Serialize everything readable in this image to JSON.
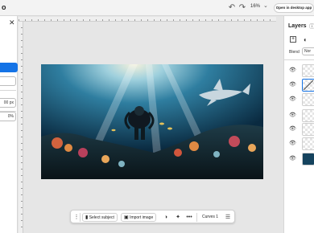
{
  "topbar": {
    "logo_text": "o",
    "undo_icon": "undo-icon",
    "redo_icon": "redo-icon",
    "zoom_label": "16%",
    "open_desktop_label": "Open in desktop app"
  },
  "left_panel": {
    "close_icon": "close-icon",
    "field_width": "00 px",
    "field_percent": "0%"
  },
  "bottom_toolbar": {
    "select_subject_label": "Select subject",
    "import_image_label": "Import image",
    "curves_label": "Curves 1"
  },
  "layers_panel": {
    "title": "Layers",
    "blend_label": "Blend",
    "blend_value": "Nor",
    "layers": [
      {
        "type": "adjustment",
        "selected": false
      },
      {
        "type": "adjustment",
        "selected": true
      },
      {
        "type": "adjustment",
        "selected": false
      },
      {
        "type": "adjustment",
        "selected": false
      },
      {
        "type": "adjustment",
        "selected": false
      },
      {
        "type": "adjustment",
        "selected": false
      },
      {
        "type": "photo",
        "selected": false
      }
    ]
  },
  "colors": {
    "accent": "#1473e6",
    "panel_bg": "#ffffff",
    "workspace_bg": "#e6e6e6"
  }
}
